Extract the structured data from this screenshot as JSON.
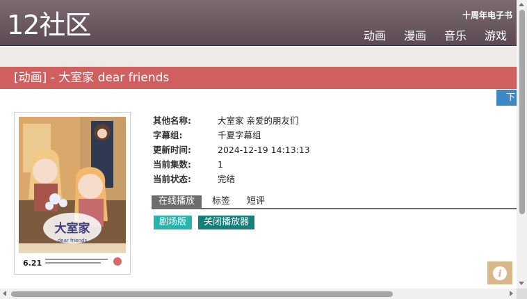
{
  "site": {
    "logo": "12社区",
    "promo": "十周年电子书",
    "nav": [
      "动画",
      "漫画",
      "音乐",
      "游戏"
    ]
  },
  "page": {
    "title": "[动画] - 大室家 dear friends",
    "download_label": "下"
  },
  "info": {
    "rows": [
      {
        "key": "其他名称:",
        "value": "大室家 亲爱的朋友们"
      },
      {
        "key": "字幕组:",
        "value": "千夏字幕组"
      },
      {
        "key": "更新时间:",
        "value": "2024-12-19 14:13:13"
      },
      {
        "key": "当前集数:",
        "value": "1"
      },
      {
        "key": "当前状态:",
        "value": "完结"
      }
    ]
  },
  "tabs": [
    "在线播放",
    "标签",
    "短评"
  ],
  "subtabs": [
    "剧场版",
    "关闭播放器"
  ],
  "poster": {
    "logo_text": "大室家",
    "sub_text": "dear friends",
    "date_text": "6.21"
  },
  "colors": {
    "header": "#6a5860",
    "title_bar": "#d05f5f",
    "download": "#3f88c5",
    "sub_btn_1": "#27b3ae",
    "sub_btn_2": "#177f7a",
    "info_btn": "#d9b78a"
  },
  "icons": {
    "info_button": "info-icon"
  }
}
